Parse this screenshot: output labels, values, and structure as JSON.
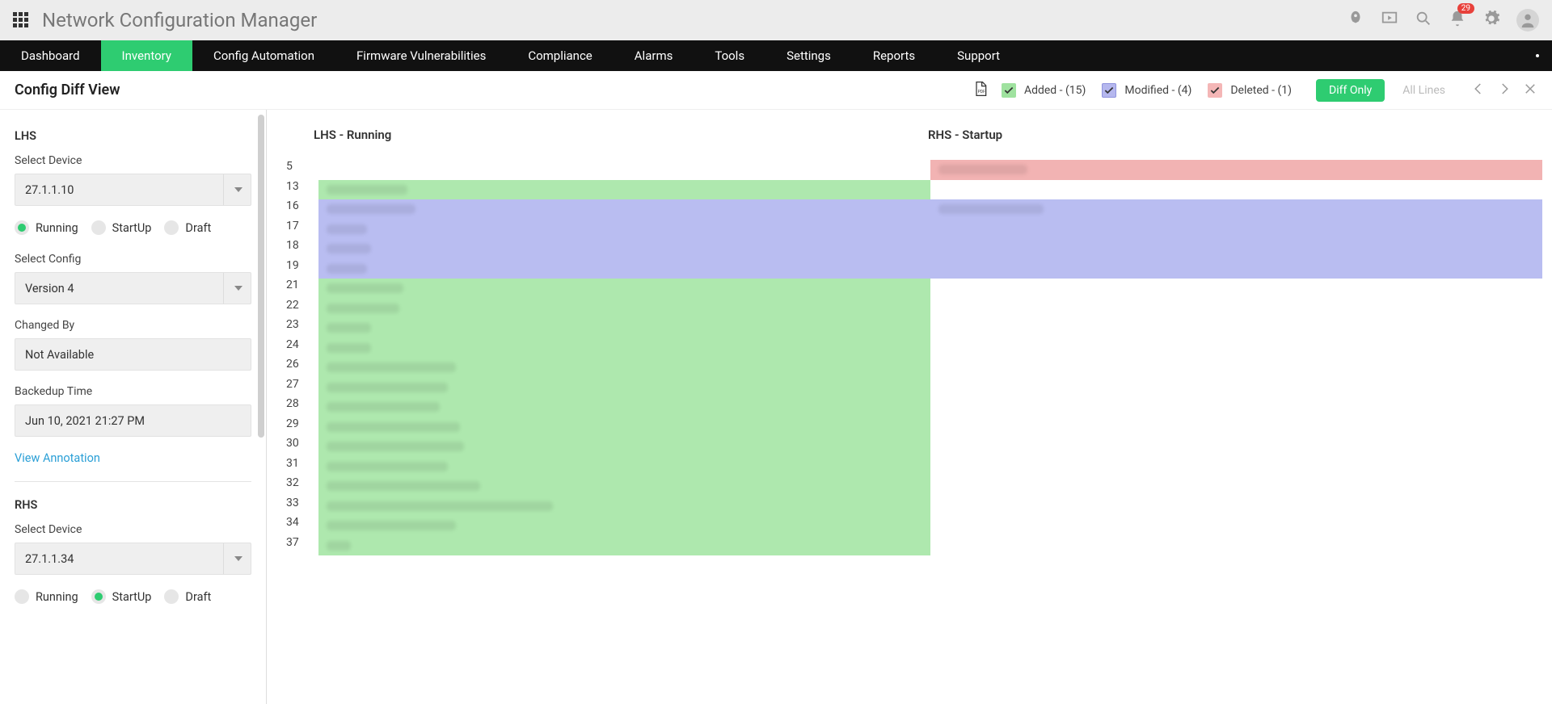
{
  "product_title": "Network Configuration Manager",
  "notification_count": "29",
  "nav": {
    "items": [
      "Dashboard",
      "Inventory",
      "Config Automation",
      "Firmware Vulnerabilities",
      "Compliance",
      "Alarms",
      "Tools",
      "Settings",
      "Reports",
      "Support"
    ],
    "active_index": 1
  },
  "toolbar": {
    "page_title": "Config Diff View",
    "added_label": "Added - (15)",
    "modified_label": "Modified - (4)",
    "deleted_label": "Deleted - (1)",
    "diff_only_label": "Diff Only",
    "all_lines_label": "All Lines"
  },
  "sidebar": {
    "lhs_title": "LHS",
    "select_device_label": "Select Device",
    "lhs_device": "27.1.1.10",
    "radio_running": "Running",
    "radio_startup": "StartUp",
    "radio_draft": "Draft",
    "select_config_label": "Select Config",
    "lhs_config": "Version 4",
    "changed_by_label": "Changed By",
    "changed_by_value": "Not Available",
    "backedup_time_label": "Backedup Time",
    "backedup_time_value": "Jun 10, 2021 21:27 PM",
    "view_annotation": "View Annotation",
    "rhs_title": "RHS",
    "rhs_device": "27.1.1.34"
  },
  "diff": {
    "lhs_header": "LHS - Running",
    "rhs_header": "RHS - Startup",
    "rows": [
      {
        "line": "5",
        "lhs": "",
        "rhs": "deleted",
        "blur_l": 0,
        "blur_r": 110
      },
      {
        "line": "13",
        "lhs": "added",
        "rhs": "",
        "blur_l": 100,
        "blur_r": 0
      },
      {
        "line": "16",
        "lhs": "modified",
        "rhs": "modified",
        "blur_l": 110,
        "blur_r": 130
      },
      {
        "line": "17",
        "lhs": "modified",
        "rhs": "modified",
        "blur_l": 50,
        "blur_r": 0
      },
      {
        "line": "18",
        "lhs": "modified",
        "rhs": "modified",
        "blur_l": 55,
        "blur_r": 0
      },
      {
        "line": "19",
        "lhs": "modified",
        "rhs": "modified",
        "blur_l": 50,
        "blur_r": 0
      },
      {
        "line": "21",
        "lhs": "added",
        "rhs": "",
        "blur_l": 95,
        "blur_r": 0
      },
      {
        "line": "22",
        "lhs": "added",
        "rhs": "",
        "blur_l": 90,
        "blur_r": 0
      },
      {
        "line": "23",
        "lhs": "added",
        "rhs": "",
        "blur_l": 55,
        "blur_r": 0
      },
      {
        "line": "24",
        "lhs": "added",
        "rhs": "",
        "blur_l": 55,
        "blur_r": 0
      },
      {
        "line": "26",
        "lhs": "added",
        "rhs": "",
        "blur_l": 160,
        "blur_r": 0
      },
      {
        "line": "27",
        "lhs": "added",
        "rhs": "",
        "blur_l": 150,
        "blur_r": 0
      },
      {
        "line": "28",
        "lhs": "added",
        "rhs": "",
        "blur_l": 140,
        "blur_r": 0
      },
      {
        "line": "29",
        "lhs": "added",
        "rhs": "",
        "blur_l": 165,
        "blur_r": 0
      },
      {
        "line": "30",
        "lhs": "added",
        "rhs": "",
        "blur_l": 170,
        "blur_r": 0
      },
      {
        "line": "31",
        "lhs": "added",
        "rhs": "",
        "blur_l": 150,
        "blur_r": 0
      },
      {
        "line": "32",
        "lhs": "added",
        "rhs": "",
        "blur_l": 190,
        "blur_r": 0
      },
      {
        "line": "33",
        "lhs": "added",
        "rhs": "",
        "blur_l": 280,
        "blur_r": 0
      },
      {
        "line": "34",
        "lhs": "added",
        "rhs": "",
        "blur_l": 160,
        "blur_r": 0
      },
      {
        "line": "37",
        "lhs": "added",
        "rhs": "",
        "blur_l": 30,
        "blur_r": 0
      }
    ]
  }
}
